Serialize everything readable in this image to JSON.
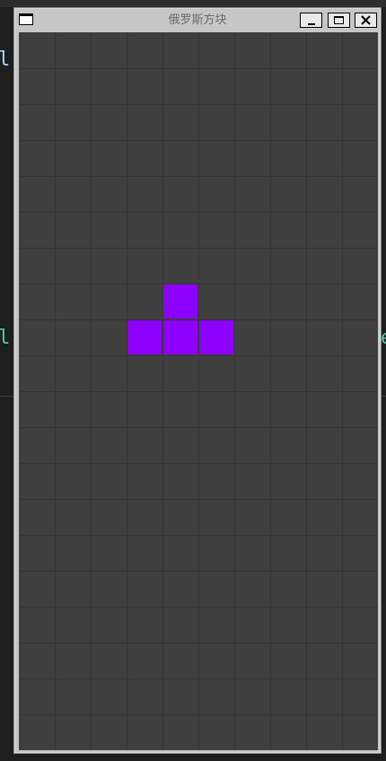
{
  "window": {
    "title": "俄罗斯方块"
  },
  "background": {
    "fragments": [
      {
        "text": "l",
        "color": "#9cdcfe"
      },
      {
        "text": "l",
        "color": "#4ec9b0"
      },
      {
        "text": "e",
        "color": "#4ec9b0"
      }
    ]
  },
  "board": {
    "columns": 10,
    "rows": 20,
    "background_color": "#3f3f3f",
    "grid_line_color": "#353535",
    "active_piece": {
      "type": "T",
      "color": "#8c00ff",
      "cells": [
        [
          4,
          7
        ],
        [
          3,
          8
        ],
        [
          4,
          8
        ],
        [
          5,
          8
        ]
      ]
    }
  },
  "icons": {
    "system_menu": "window-icon",
    "minimize": "minimize-icon",
    "maximize": "maximize-icon",
    "close": "close-icon"
  }
}
